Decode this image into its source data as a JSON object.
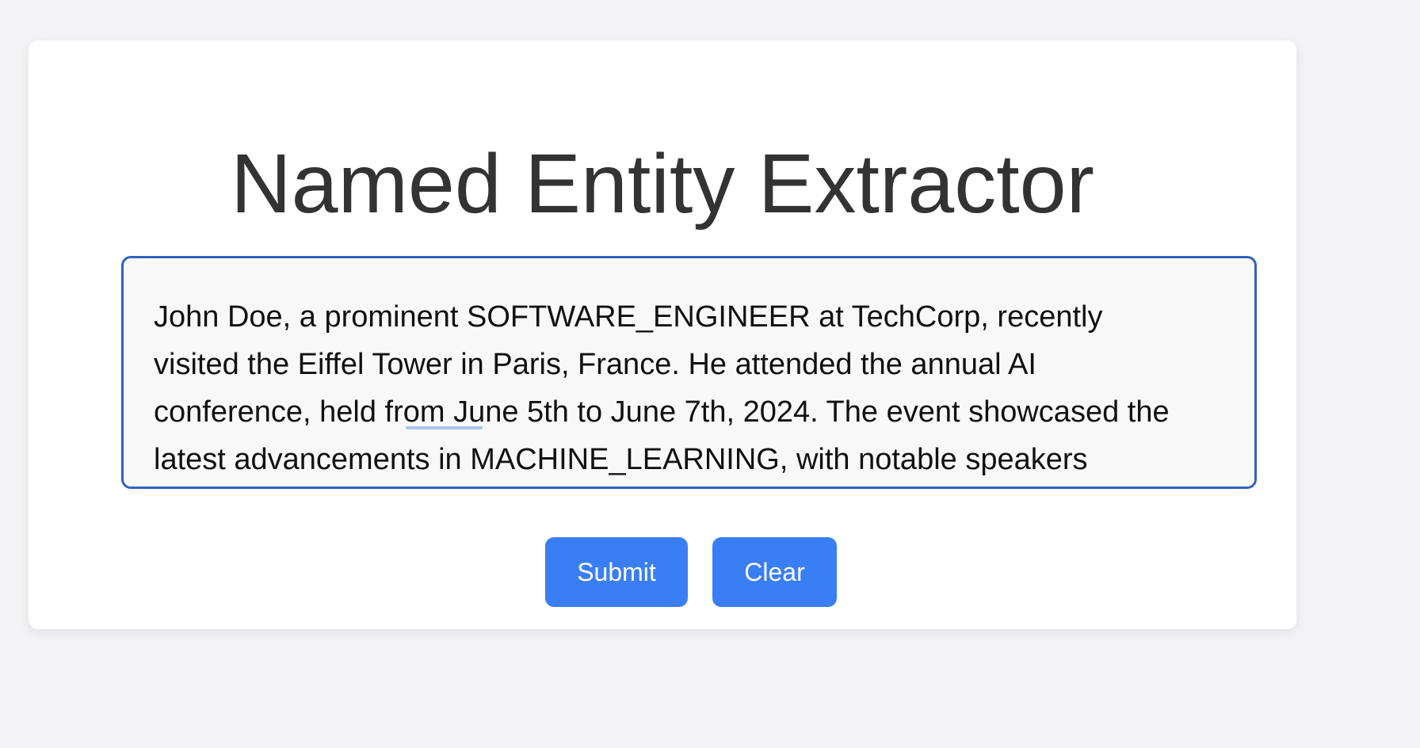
{
  "app": {
    "title": "Named Entity Extractor"
  },
  "textarea": {
    "lines": [
      "John Doe, a prominent SOFTWARE_ENGINEER at TechCorp, recently",
      "visited the Eiffel Tower in Paris, France. He attended the annual AI",
      "conference, held from June 5th to June 7th, 2024. The event showcased the",
      "latest advancements in MACHINE_LEARNING, with notable speakers"
    ]
  },
  "buttons": {
    "submit_label": "Submit",
    "clear_label": "Clear"
  },
  "colors": {
    "accent": "#3a7ef5",
    "focus_border": "#2f63c0",
    "indicator_dot": "#d9312b",
    "title_text": "#333333"
  }
}
